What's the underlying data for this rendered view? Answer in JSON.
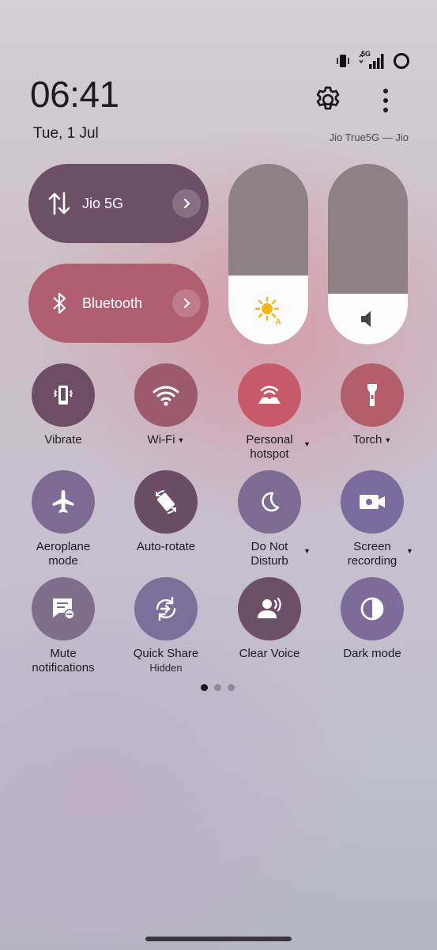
{
  "status_bar": {
    "network_label": "5G",
    "icons": [
      "vibrate-icon",
      "signal-icon",
      "battery-ring-icon"
    ]
  },
  "header": {
    "time": "06:41",
    "date": "Tue, 1 Jul",
    "carrier": "Jio True5G — Jio",
    "settings_icon": "gear-icon",
    "more_icon": "more-vertical-icon"
  },
  "big_tiles": [
    {
      "label": "Jio 5G",
      "icon": "data-arrows-icon",
      "color": "#6e5066"
    },
    {
      "label": "Bluetooth",
      "icon": "bluetooth-icon",
      "color": "#b05f71"
    }
  ],
  "sliders": {
    "brightness": {
      "level": 0.38,
      "icon": "auto-brightness-icon",
      "icon_color": "#f3b51c"
    },
    "volume": {
      "level": 0.28,
      "icon": "speaker-icon"
    }
  },
  "tiles": [
    {
      "label": "Vibrate",
      "color": "#6d4d63",
      "icon": "vibrate-icon"
    },
    {
      "label": "Wi-Fi",
      "color": "#9b5b6d",
      "icon": "wifi-icon"
    },
    {
      "label": "Personal\nhotspot",
      "color": "#c65a6b",
      "icon": "hotspot-icon"
    },
    {
      "label": "Torch",
      "color": "#b45e6c",
      "icon": "torch-icon"
    },
    {
      "label": "Aeroplane\nmode",
      "color": "#7c6b92",
      "icon": "airplane-icon"
    },
    {
      "label": "Auto-rotate",
      "color": "#6b4d63",
      "icon": "rotate-icon"
    },
    {
      "label": "Do Not\nDisturb",
      "color": "#7c6b92",
      "icon": "moon-icon"
    },
    {
      "label": "Screen\nrecording",
      "color": "#7c6b9e",
      "icon": "screen-record-icon"
    },
    {
      "label": "Mute\nnotifications",
      "color": "#7e6f8c",
      "icon": "mute-notification-icon"
    },
    {
      "label": "Quick Share",
      "sub": "Hidden",
      "color": "#7c6f9a",
      "icon": "quick-share-icon"
    },
    {
      "label": "Clear Voice",
      "color": "#6d4f66",
      "icon": "clear-voice-icon"
    },
    {
      "label": "Dark mode",
      "color": "#7d6b9a",
      "icon": "dark-mode-icon"
    }
  ],
  "pager": {
    "pages": 3,
    "current": 1
  }
}
